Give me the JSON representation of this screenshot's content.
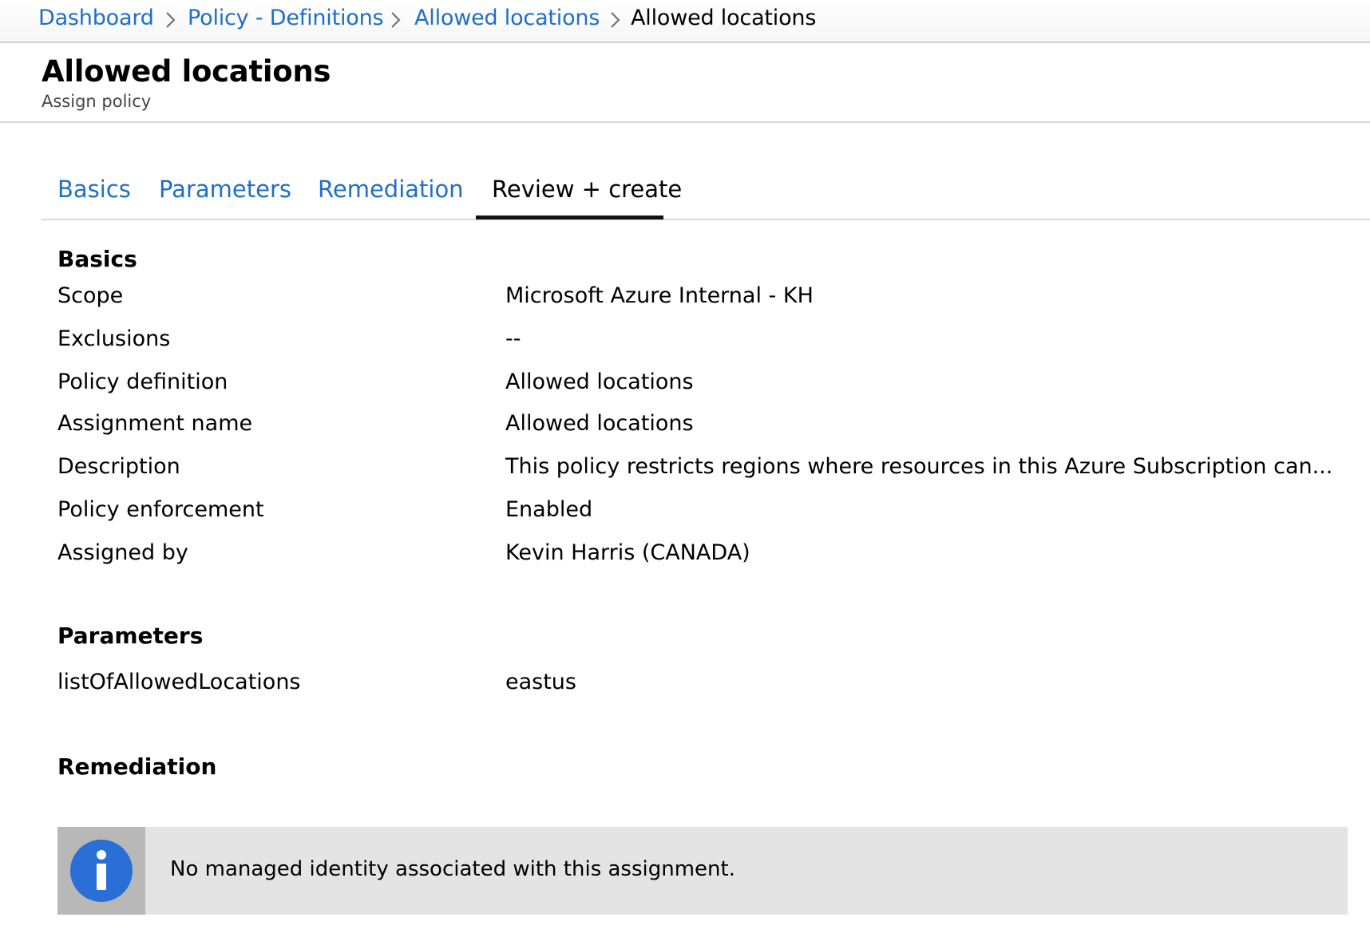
{
  "breadcrumb": {
    "items": [
      {
        "label": "Dashboard"
      },
      {
        "label": "Policy - Definitions"
      },
      {
        "label": "Allowed locations"
      },
      {
        "label": "Allowed locations"
      }
    ]
  },
  "header": {
    "title": "Allowed locations",
    "subtitle": "Assign policy"
  },
  "tabs": [
    {
      "label": "Basics"
    },
    {
      "label": "Parameters"
    },
    {
      "label": "Remediation"
    },
    {
      "label": "Review + create"
    }
  ],
  "active_tab": "Review + create",
  "basics": {
    "title": "Basics",
    "rows": [
      {
        "label": "Scope",
        "value": "Microsoft Azure Internal - KH"
      },
      {
        "label": "Exclusions",
        "value": "--"
      },
      {
        "label": "Policy definition",
        "value": "Allowed locations"
      },
      {
        "label": "Assignment name",
        "value": "Allowed locations"
      },
      {
        "label": "Description",
        "value": "This policy restricts regions where resources in this Azure Subscription can..."
      },
      {
        "label": "Policy enforcement",
        "value": "Enabled"
      },
      {
        "label": "Assigned by",
        "value": "Kevin Harris (CANADA)"
      }
    ]
  },
  "parameters": {
    "title": "Parameters",
    "rows": [
      {
        "label": "listOfAllowedLocations",
        "value": "eastus"
      }
    ]
  },
  "remediation": {
    "title": "Remediation",
    "info_message": "No managed identity associated with this assignment.",
    "info_icon": "info-circle-icon"
  },
  "colors": {
    "link": "#1f6fc5",
    "info_icon_bg": "#2a6fd6",
    "info_box_bg": "#e4e4e4"
  }
}
